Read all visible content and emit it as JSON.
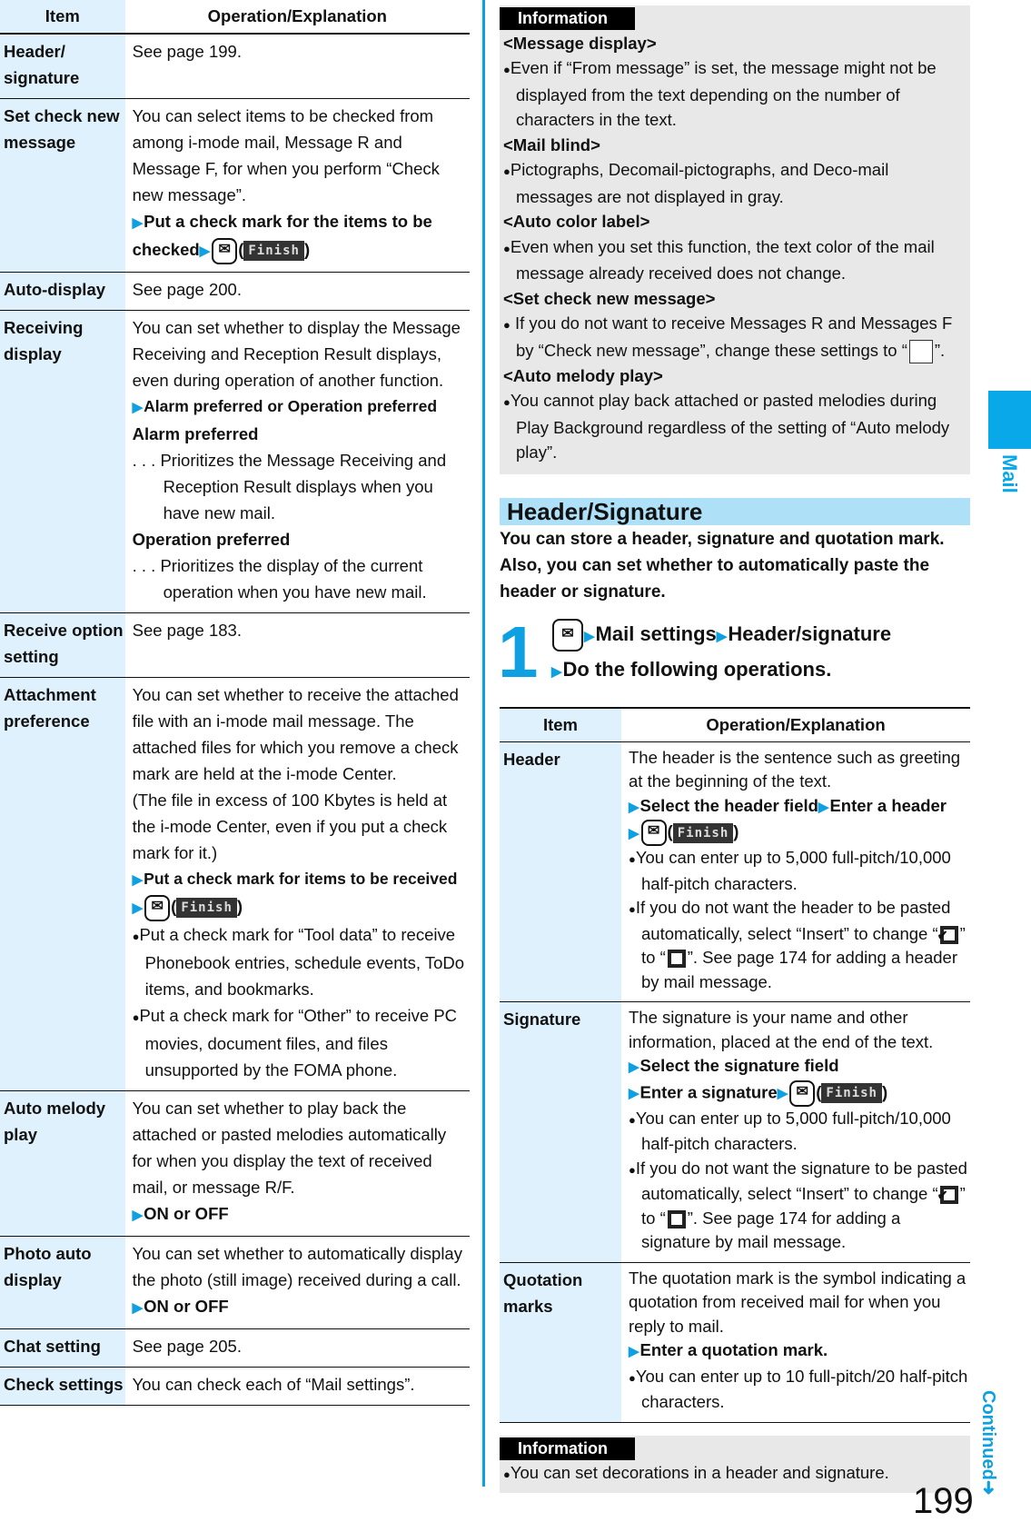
{
  "left_table": {
    "headers": [
      "Item",
      "Operation/Explanation"
    ],
    "rows": [
      {
        "item": "Header/ signature",
        "text": "See page 199."
      },
      {
        "item": "Set check new message",
        "text": "You can select items to be checked from among i-mode mail, Message R and Message F, for when you perform “Check new message”.",
        "op": "Put a check mark for the items to be checked",
        "finish": "Finish"
      },
      {
        "item": "Auto-display",
        "text": "See page 200."
      },
      {
        "item": "Receiving display",
        "text": "You can set whether to display the Message Receiving and Reception Result displays, even during operation of another function.",
        "op": "Alarm preferred or Operation preferred",
        "opt1_label": "Alarm preferred",
        "opt1_desc": ". . . Prioritizes the Message Receiving and Reception Result displays when you have new mail.",
        "opt2_label": "Operation preferred",
        "opt2_desc": ". . . Prioritizes the display of the current operation when you have new mail."
      },
      {
        "item": "Receive option setting",
        "text": "See page 183."
      },
      {
        "item": "Attachment preference",
        "text": "You can set whether to receive the attached file with an i-mode mail message. The attached files for which you remove a check mark are held at the i-mode Center.",
        "text2": "(The file in excess of 100 Kbytes is held at the i-mode Center, even if you put a check mark for it.)",
        "op": "Put a check mark for items to be received",
        "finish": "Finish",
        "bullets": [
          "Put a check mark for “Tool data” to receive Phonebook entries, schedule events, ToDo items, and bookmarks.",
          "Put a check mark for “Other” to receive PC movies, document files, and files unsupported by the FOMA phone."
        ]
      },
      {
        "item": "Auto melody play",
        "text": "You can set whether to play back the attached or pasted melodies automatically for when you display the text of received mail, or message R/F.",
        "op": "ON or OFF"
      },
      {
        "item": "Photo auto display",
        "text": "You can set whether to automatically display the photo (still image) received during a call.",
        "op": "ON or OFF"
      },
      {
        "item": "Chat setting",
        "text": "See page 205."
      },
      {
        "item": "Check settings",
        "text": "You can check each of “Mail settings”."
      }
    ]
  },
  "info_box_1": {
    "tag": "Information",
    "sections": [
      {
        "title": "<Message display>",
        "text": "Even if “From message” is set, the message might not be displayed from the text depending on the number of characters in the text."
      },
      {
        "title": "<Mail blind>",
        "text": "Pictographs, Decomail-pictographs, and Deco-mail messages are not displayed in gray."
      },
      {
        "title": "<Auto color label>",
        "text": "Even when you set this function, the text color of the mail message already received does not change."
      },
      {
        "title": "<Set check new message>",
        "text": " If you do not want to receive Messages R and Messages F by “Check new message”, change these settings to “",
        "text_end": "”."
      },
      {
        "title": "<Auto melody play>",
        "text": "You cannot play back attached or pasted melodies during Play Background regardless of the setting of “Auto melody play”."
      }
    ]
  },
  "section": {
    "title": "Header/Signature",
    "intro": "You can store a header, signature and quotation mark. Also, you can set whether to automatically paste the header or signature.",
    "step_number": "1",
    "step_parts": [
      "Mail settings",
      "Header/signature",
      "Do the following operations."
    ]
  },
  "right_table": {
    "headers": [
      "Item",
      "Operation/Explanation"
    ],
    "rows": [
      {
        "item": "Header",
        "text": "The header is the sentence such as greeting at the beginning of the text.",
        "op1": "Select the header field",
        "op2": "Enter a header",
        "finish": "Finish",
        "bullet1": "You can enter up to 5,000 full-pitch/10,000 half-pitch characters.",
        "bullet2a": "If you do not want the header to be pasted automatically, select “Insert” to change “",
        "bullet2b": "” to “",
        "bullet2c": "”. See page 174 for adding a header by mail message."
      },
      {
        "item": "Signature",
        "text": "The signature is your name and other information, placed at the end of the text.",
        "op1": "Select the signature field",
        "op2": "Enter a signature",
        "finish": "Finish",
        "bullet1": "You can enter up to 5,000 full-pitch/10,000 half-pitch characters.",
        "bullet2a": "If you do not want the signature to be pasted automatically, select “Insert” to change “",
        "bullet2b": "” to “",
        "bullet2c": "”. See page 174 for adding a signature by mail message."
      },
      {
        "item": "Quotation marks",
        "text": "The quotation mark is the symbol indicating a quotation from received mail for when you reply to mail.",
        "op1": "Enter a quotation mark.",
        "bullet1": "You can enter up to 10 full-pitch/20 half-pitch characters."
      }
    ]
  },
  "info_box_2": {
    "tag": "Information",
    "text": "You can set decorations in a header and signature."
  },
  "side_tab": {
    "label": "Mail"
  },
  "footer": {
    "continued": "Continued",
    "page_number": "199"
  },
  "icons": {
    "mail_key": "✉",
    "arrow": "▶",
    "bullet": "●",
    "check": "✔"
  }
}
